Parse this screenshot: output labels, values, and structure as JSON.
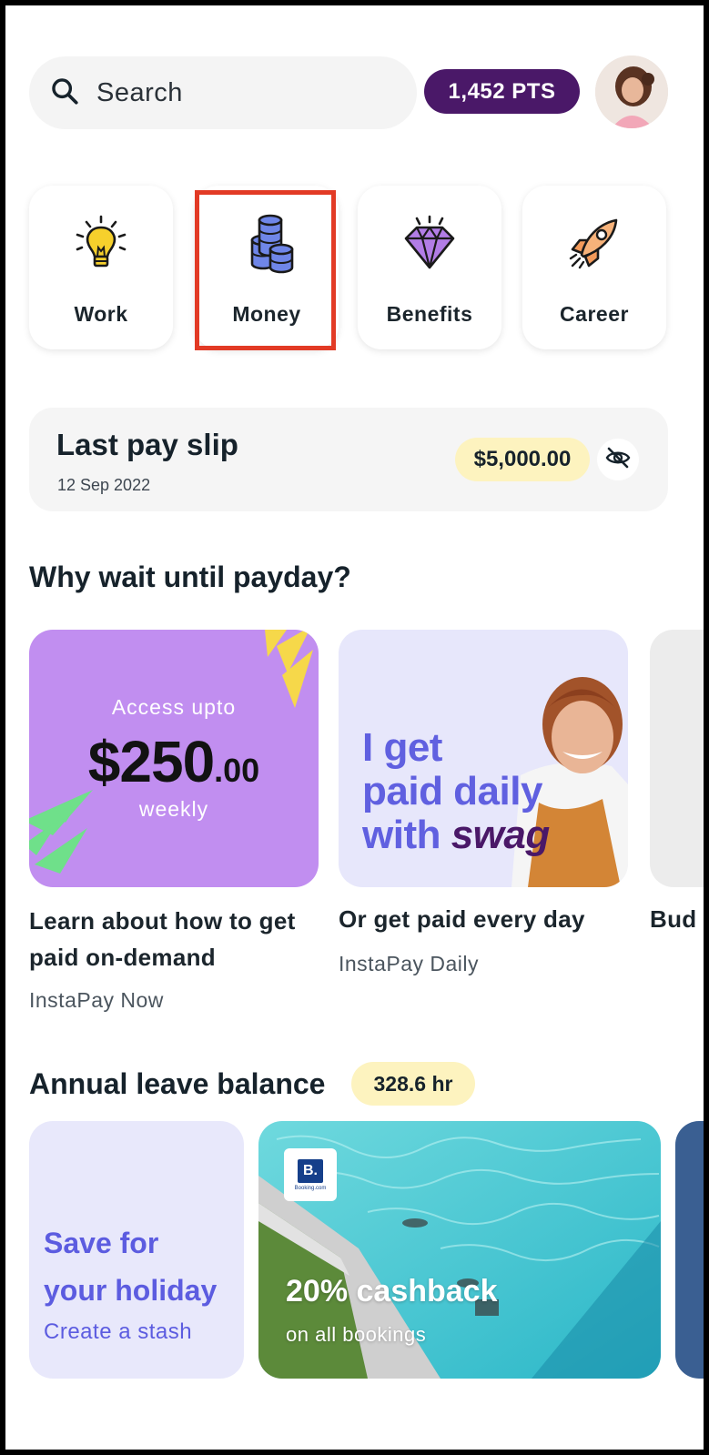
{
  "header": {
    "search_placeholder": "Search",
    "points": "1,452 PTS"
  },
  "categories": [
    {
      "label": "Work",
      "icon": "lightbulb-icon"
    },
    {
      "label": "Money",
      "icon": "coins-icon"
    },
    {
      "label": "Benefits",
      "icon": "diamond-icon"
    },
    {
      "label": "Career",
      "icon": "rocket-icon"
    }
  ],
  "pay_slip": {
    "title": "Last pay slip",
    "date": "12 Sep 2022",
    "amount": "$5,000.00"
  },
  "payday": {
    "heading": "Why wait until payday?",
    "cards": [
      {
        "banner_top": "Access upto",
        "banner_amount": "$250",
        "banner_cents": ".00",
        "banner_bottom": "weekly",
        "title": "Learn about how to get paid on-demand",
        "subtitle": "InstaPay Now"
      },
      {
        "banner_line1": "I get",
        "banner_line2": "paid daily",
        "banner_line3a": "with ",
        "banner_line3b": "swag",
        "title": "Or get paid every day",
        "subtitle": "InstaPay Daily"
      },
      {
        "title": "Bud"
      }
    ]
  },
  "leave": {
    "heading": "Annual leave balance",
    "balance": "328.6 hr",
    "holiday_title_1": "Save for",
    "holiday_title_2": "your holiday",
    "holiday_link": "Create a stash",
    "promo_big": "20% cashback",
    "promo_small": "on all bookings",
    "promo_logo": "B.",
    "promo_logo_text": "Booking.com"
  },
  "colors": {
    "brand_purple": "#4a1868",
    "highlight_red": "#e23a25",
    "card_lilac": "#c18ef0",
    "accent_blue": "#5c5ce0",
    "badge_yellow": "#fdf3bf"
  }
}
